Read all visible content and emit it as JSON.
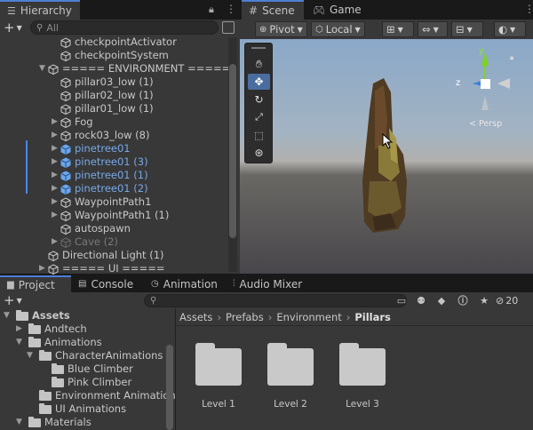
{
  "hierarchy": {
    "tab_label": "Hierarchy",
    "search_placeholder": "All",
    "rows": [
      {
        "label": "checkpointActivator",
        "style": "normal"
      },
      {
        "label": "checkpointSystem",
        "style": "normal"
      },
      {
        "label": "===== ENVIRONMENT =====",
        "style": "normal"
      },
      {
        "label": "pillar03_low (1)",
        "style": "normal"
      },
      {
        "label": "pillar02_low (1)",
        "style": "normal"
      },
      {
        "label": "pillar01_low (1)",
        "style": "normal"
      },
      {
        "label": "Fog",
        "style": "normal"
      },
      {
        "label": "rock03_low (8)",
        "style": "normal"
      },
      {
        "label": "pinetree01",
        "style": "selected"
      },
      {
        "label": "pinetree01 (3)",
        "style": "selected"
      },
      {
        "label": "pinetree01 (1)",
        "style": "selected"
      },
      {
        "label": "pinetree01 (2)",
        "style": "selected"
      },
      {
        "label": "WaypointPath1",
        "style": "normal"
      },
      {
        "label": "WaypointPath1 (1)",
        "style": "normal"
      },
      {
        "label": "autospawn",
        "style": "normal"
      },
      {
        "label": "Cave (2)",
        "style": "disabled"
      },
      {
        "label": "Directional Light (1)",
        "style": "normal"
      },
      {
        "label": "===== UI =====",
        "style": "normal"
      }
    ]
  },
  "scene": {
    "tab_scene": "Scene",
    "tab_game": "Game",
    "pivot_label": "Pivot",
    "local_label": "Local",
    "persp_label": "< Persp",
    "gizmo_z": "z",
    "gizmo_y": "y"
  },
  "bottom_tabs": {
    "project": "Project",
    "console": "Console",
    "animation": "Animation",
    "audio_mixer": "Audio Mixer"
  },
  "project": {
    "hidden_count": "20",
    "tree": [
      {
        "label": "Assets",
        "bold": true
      },
      {
        "label": "Andtech",
        "bold": false
      },
      {
        "label": "Animations",
        "bold": false
      },
      {
        "label": "CharacterAnimations",
        "bold": false
      },
      {
        "label": "Blue Climber",
        "bold": false
      },
      {
        "label": "Pink Climber",
        "bold": false
      },
      {
        "label": "Environment Animation",
        "bold": false
      },
      {
        "label": "UI Animations",
        "bold": false
      },
      {
        "label": "Materials",
        "bold": false
      }
    ],
    "breadcrumb": [
      "Assets",
      "Prefabs",
      "Environment",
      "Pillars"
    ],
    "folders": [
      "Level 1",
      "Level 2",
      "Level 3"
    ]
  },
  "colors": {
    "selection_blue": "#76a8e8",
    "tab_accent": "#4c7fd6"
  }
}
